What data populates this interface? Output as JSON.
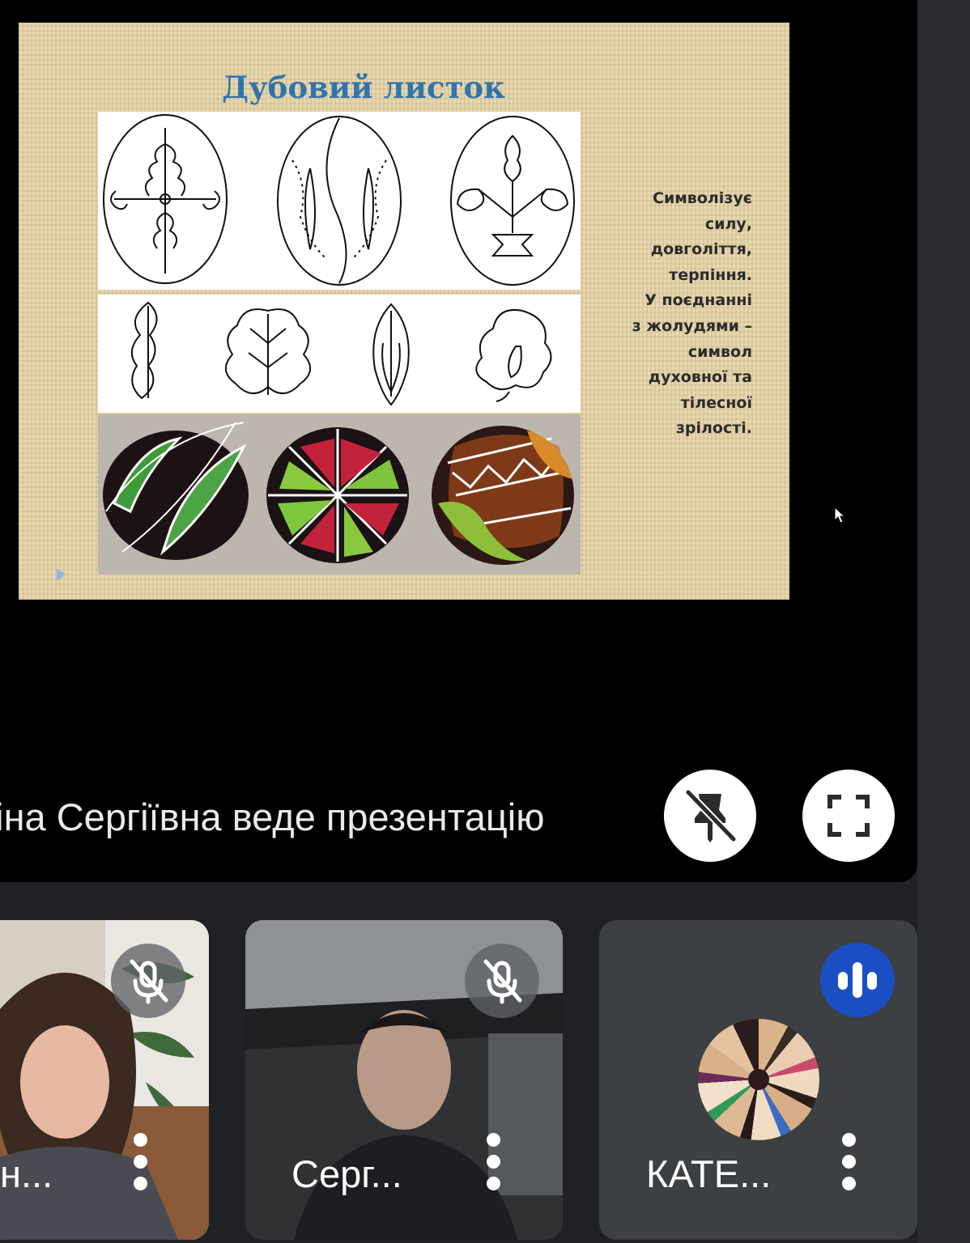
{
  "slide": {
    "title": "Дубовий листок",
    "body": "Символізує\nсилу,\nдовголіття,\nтерпіння.\nУ поєднанні\nз жолудями –\nсимвол\nдуховної та\nтілесної\nзрілості."
  },
  "presenter_bar": {
    "presenting_text": "ріна Сергіївна веде презентацію",
    "unpin_icon": "pin-off-icon",
    "fullscreen_icon": "fullscreen-icon"
  },
  "participants": [
    {
      "name": "н...",
      "mic": "muted"
    },
    {
      "name": "Серг...",
      "mic": "muted"
    },
    {
      "name": "КАТЕ...",
      "mic": "speaking"
    }
  ],
  "colors": {
    "stage_bg": "#000000",
    "app_bg": "#202124",
    "tile_bg": "#3c4043",
    "speaking_accent": "#1a4fc4",
    "slide_title": "#2f75ad"
  }
}
